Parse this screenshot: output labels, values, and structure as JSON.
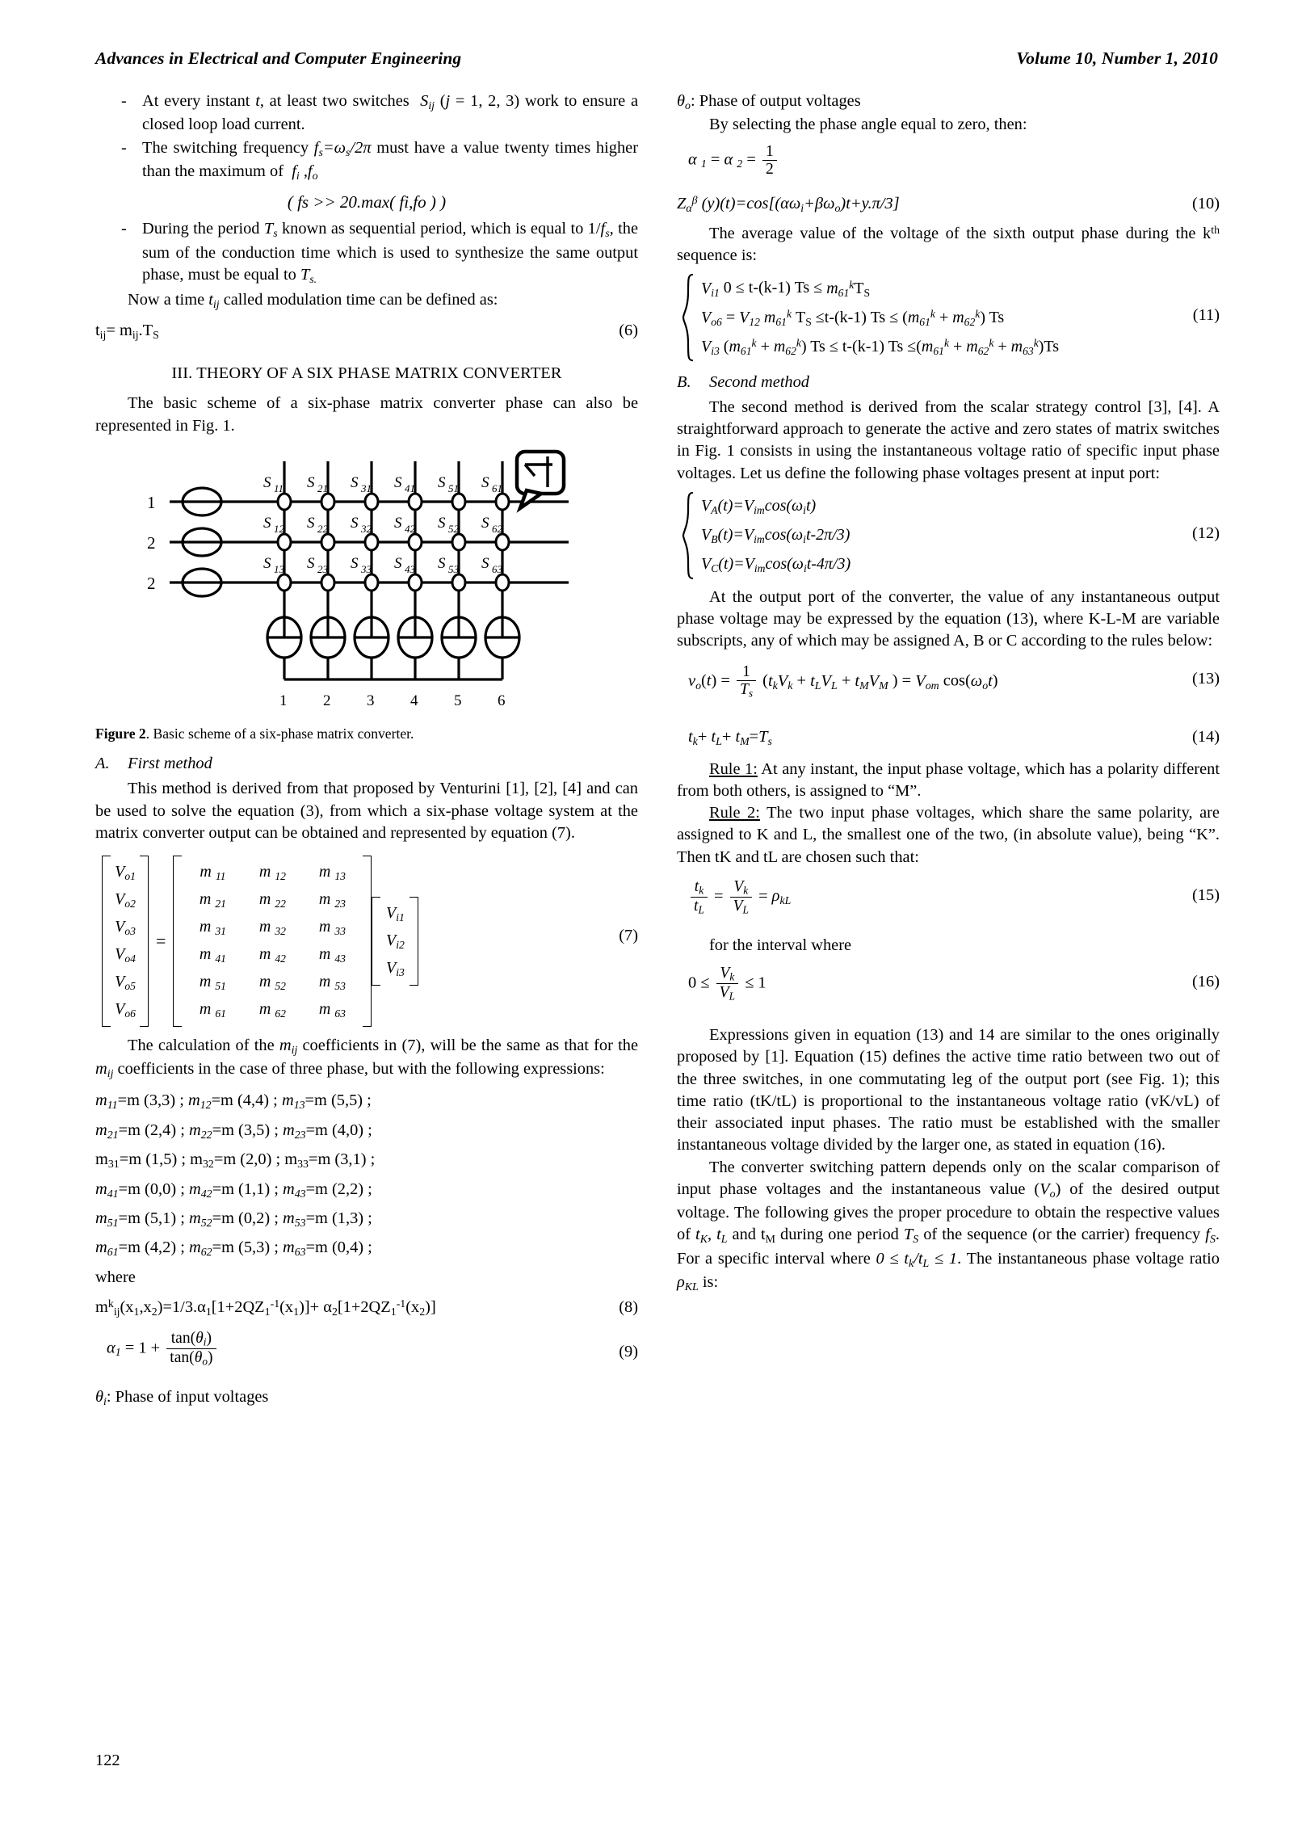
{
  "header": {
    "journal": "Advances in Electrical and Computer Engineering",
    "volume": "Volume 10, Number 1, 2010"
  },
  "page_number": "122",
  "left_column": {
    "bullets": [
      {
        "dash": "-",
        "text_plain": "At every instant t, at least two switches Sij (j = 1, 2, 3) work to ensure a closed loop load current."
      },
      {
        "dash": "-",
        "text_plain": "The switching frequency fs=ωs/2π must have a value twenty times higher than the maximum of fi ,fo"
      },
      {
        "dash": "-",
        "text_plain": "During the period Ts known as sequential period, which is equal to 1/fs, the sum of the conduction time which is used to synthesize the same output phase, must be equal to Ts."
      }
    ],
    "bullet2_formula": "( fs >> 20.max( fi,fo ) )",
    "para_modulation": "Now a time tij called modulation time can be defined as:",
    "eq6": {
      "body": "tij= mij.TS",
      "num": "(6)"
    },
    "section_title": "III.   THEORY OF A SIX PHASE MATRIX CONVERTER",
    "para_scheme": "The basic scheme of a six-phase matrix converter phase can also be represented in Fig. 1.",
    "figure": {
      "caption_bold": "Figure 2",
      "caption_rest": ". Basic scheme of a six-phase matrix converter.",
      "input_labels": [
        "1",
        "2",
        "2"
      ],
      "output_labels": [
        "1",
        "2",
        "3",
        "4",
        "5",
        "6"
      ],
      "switch_rows": [
        [
          "S11",
          "S21",
          "S31",
          "S41",
          "S51",
          "S61"
        ],
        [
          "S12",
          "S22",
          "S32",
          "S42",
          "S52",
          "S62"
        ],
        [
          "S13",
          "S23",
          "S33",
          "S43",
          "S53",
          "S63"
        ]
      ]
    },
    "sub_a": {
      "label": "A.",
      "title": "First method"
    },
    "para_first_method": "This method is derived from that proposed by Venturini [1], [2], [4] and can be used to solve the equation (3), from which a six-phase voltage system at the matrix  converter output can be obtained and represented by equation (7).",
    "eq7": {
      "num": "(7)",
      "output_vector": [
        "Vo1",
        "Vo2",
        "Vo3",
        "Vo4",
        "Vo5",
        "Vo6"
      ],
      "m_matrix": [
        [
          "m 11",
          "m 12",
          "m 13"
        ],
        [
          "m 21",
          "m 22",
          "m 23"
        ],
        [
          "m 31",
          "m 32",
          "m 33"
        ],
        [
          "m 41",
          "m 42",
          "m 43"
        ],
        [
          "m 51",
          "m 52",
          "m 53"
        ],
        [
          "m 61",
          "m 62",
          "m 63"
        ]
      ],
      "input_vector": [
        "Vi1",
        "Vi2",
        "Vi3"
      ]
    },
    "para_calc": "The calculation of the mij coefficients in (7), will be the same as that for the mij coefficients in the case of three phase, but with the following expressions:",
    "m_expressions": [
      "m11=m (3,3) ; m12=m (4,4) ; m13=m (5,5) ;",
      "m21=m (2,4) ; m22=m (3,5) ; m23=m (4,0) ;",
      "m31=m (1,5) ; m32=m (2,0) ; m33=m (3,1) ;",
      "m41=m (0,0) ; m42=m (1,1) ; m43=m (2,2) ;",
      "m51=m (5,1) ; m52=m (0,2) ; m53=m (1,3) ;",
      "m61=m (4,2) ; m62=m (5,3) ; m63=m (0,4) ;"
    ],
    "where_label": "where",
    "eq8": {
      "body": "mkij(x1,x2)=1/3.α1[1+2QZ1-1(x1)]+ α2[1+2QZ1-1(x2)]",
      "num": "(8)"
    },
    "eq9": {
      "body": "α1 = 1 + tan(θi)/tan(θo)",
      "num": "(9)"
    },
    "theta_i_def": "θi: Phase of input voltages"
  },
  "right_column": {
    "theta_o_def": "θo: Phase of output voltages",
    "para_selecting": "By selecting the phase angle equal to zero, then:",
    "alpha_eq": "α1 = α2 = 1/2",
    "eq10": {
      "body": "Zαβ (y)(t)=cos[(αωi+βωo)t+y.π/3]",
      "num": "(10)"
    },
    "para_average": "The average value of the voltage of the sixth output phase during the kth sequence is:",
    "eq11": {
      "num": "(11)",
      "lines": [
        "Vi1 0 ≤ t-(k-1) Ts ≤ m61k TS",
        "Vo6 = Vi2 m61k TS ≤t-(k-1) Ts ≤ (m61k + m62k) Ts",
        "Vi3 (m61k + m62k) Ts ≤ t-(k-1) Ts ≤ (m61k + m62k + m63k)Ts"
      ]
    },
    "sub_b": {
      "label": "B.",
      "title": "Second method"
    },
    "para_second_method": "The second method is derived from the scalar strategy control [3], [4]. A straightforward approach to generate the active and zero states of matrix switches in Fig. 1 consists in using the instantaneous voltage ratio of specific input phase voltages. Let us define the following phase voltages present at input port:",
    "eq12": {
      "num": "(12)",
      "lines": [
        "VA(t)=Vimcos(ωit)",
        "VB(t)=Vimcos(ωit-2π/3)",
        "VC(t)=Vimcos(ωit-4π/3)"
      ]
    },
    "para_output_port": "At the output port of the converter, the value of any instantaneous output phase voltage may be expressed by the equation (13), where K-L-M are variable subscripts, any of which may be assigned A, B or C according to the rules below:",
    "eq13": {
      "body": "vo(t) = 1/Ts (tkVk + tLVL + tMVM ) = Vom cos(ωot)",
      "num": "(13)"
    },
    "eq14": {
      "body": "tk+ tL+ tM=Ts",
      "num": "(14)"
    },
    "rule1": {
      "label": "Rule 1:",
      "text": " At any instant, the input phase voltage, which has a polarity different from both others, is assigned to “M”."
    },
    "rule2": {
      "label": "Rule 2:",
      "text": " The two input phase voltages, which share the same polarity, are assigned to K and L, the smallest one of the two, (in absolute value), being “K”. Then tK and tL are chosen such that:"
    },
    "eq15": {
      "body": "tk/tL = Vk/VL = ρkL",
      "num": "(15)"
    },
    "interval_label": "for the interval where",
    "eq16": {
      "body": "0 ≤ Vk/VL ≤ 1",
      "num": "(16)"
    },
    "para_expressions": "Expressions given in equation (13) and 14 are similar to the ones originally proposed by [1]. Equation (15) defines the active time ratio between two out of the three switches, in one commutating leg of the output port (see Fig. 1); this time ratio (tK/tL) is proportional to the instantaneous voltage ratio (vK/vL) of their associated input phases. The ratio must be established with the smaller instantaneous voltage divided by the larger one, as stated in equation (16).",
    "para_switching": "The converter switching pattern depends only on the scalar comparison of input phase voltages and the instantaneous value (Vo) of the desired output voltage. The following gives the proper procedure to obtain the respective values of tK, tL and tM during one period TS of the sequence (or the carrier) frequency fS. For a specific interval where 0 ≤ tk/tL ≤ 1. The instantaneous phase voltage ratio ρKL is:"
  }
}
